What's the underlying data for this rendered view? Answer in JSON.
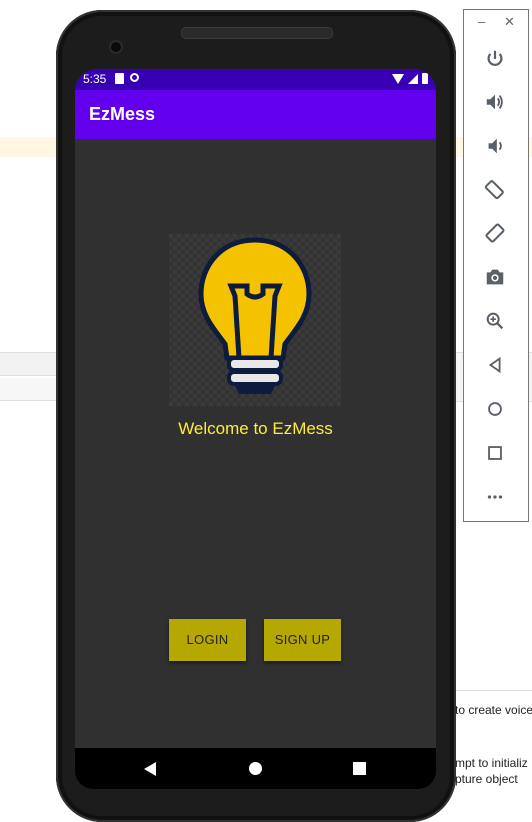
{
  "background_ide": {
    "line1": "to create voice",
    "line2": "mpt to initializ",
    "line3": "pture object"
  },
  "status_bar": {
    "time": "5:35"
  },
  "app_bar": {
    "title": "EzMess"
  },
  "main": {
    "welcome_text": "Welcome to EzMess",
    "login_label": "LOGIN",
    "signup_label": "SIGN UP"
  },
  "colors": {
    "status_bar": "#3700b3",
    "app_bar": "#6200ee",
    "screen_bg": "#303030",
    "welcome_text": "#ffeb3b",
    "button_bg": "#b5a800",
    "bulb_yellow": "#f5c200",
    "bulb_outline": "#0d1b3e"
  },
  "emulator_panel": {
    "controls": [
      "power-icon",
      "volume-up-icon",
      "volume-down-icon",
      "rotate-left-icon",
      "rotate-right-icon",
      "camera-icon",
      "zoom-icon",
      "back-icon",
      "home-icon",
      "overview-icon",
      "more-icon"
    ]
  }
}
